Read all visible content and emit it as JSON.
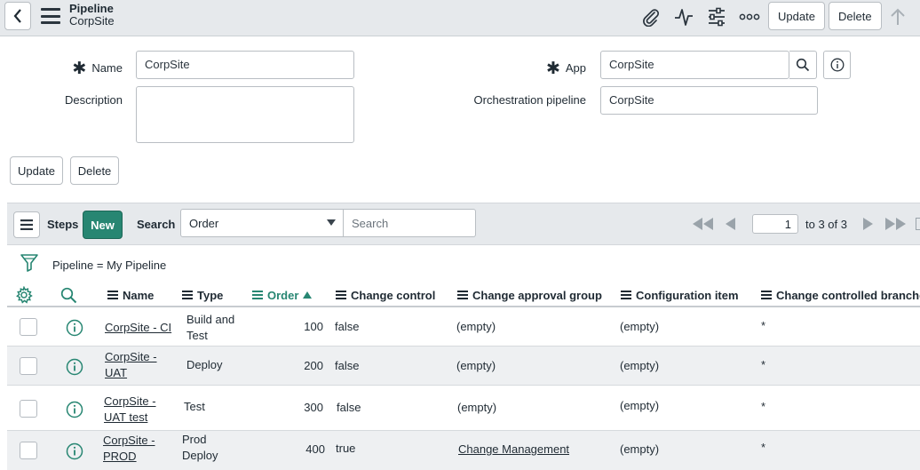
{
  "header": {
    "title": "Pipeline",
    "subtitle": "CorpSite",
    "update_label": "Update",
    "delete_label": "Delete"
  },
  "form": {
    "name_label": "Name",
    "name_value": "CorpSite",
    "description_label": "Description",
    "description_value": "",
    "app_label": "App",
    "app_value": "CorpSite",
    "orchestration_label": "Orchestration pipeline",
    "orchestration_value": "CorpSite",
    "update_label": "Update",
    "delete_label": "Delete"
  },
  "list": {
    "title": "Steps",
    "new_label": "New",
    "search_label": "Search",
    "search_field": "Order",
    "search_placeholder": "Search",
    "page_value": "1",
    "page_of": "to 3 of 3",
    "breadcrumb": "Pipeline = My Pipeline",
    "columns": {
      "name": "Name",
      "type": "Type",
      "order": "Order",
      "change_control": "Change control",
      "change_approval_group": "Change approval group",
      "configuration_item": "Configuration item",
      "change_controlled_branches": "Change controlled branches"
    },
    "rows": [
      {
        "name_1": "CorpSite - CI",
        "name_2": "",
        "type_1": "Build and",
        "type_2": "Test",
        "order": "100",
        "change_control": "false",
        "approval_group": "(empty)",
        "config_item": "(empty)",
        "branches": "*"
      },
      {
        "name_1": "CorpSite -",
        "name_2": "UAT",
        "type_1": "Deploy",
        "type_2": "",
        "order": "200",
        "change_control": "false",
        "approval_group": "(empty)",
        "config_item": "(empty)",
        "branches": "*"
      },
      {
        "name_1": "CorpSite -",
        "name_2": "UAT test",
        "type_1": "Test",
        "type_2": "",
        "order": "300",
        "change_control": "false",
        "approval_group": "(empty)",
        "config_item": "(empty)",
        "branches": "*"
      },
      {
        "name_1": "CorpSite -",
        "name_2": "PROD",
        "type_1": "Prod",
        "type_2": "Deploy",
        "order": "400",
        "change_control": "true",
        "approval_group": "Change Management",
        "config_item": "(empty)",
        "branches": "*"
      }
    ]
  },
  "colors": {
    "accent": "#278672",
    "header_bg": "#e6e9ec"
  }
}
